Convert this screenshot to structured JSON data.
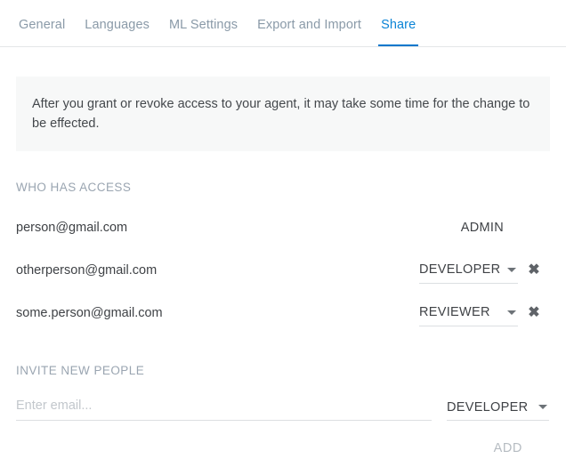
{
  "tabs": [
    {
      "label": "General",
      "active": false
    },
    {
      "label": "Languages",
      "active": false
    },
    {
      "label": "ML Settings",
      "active": false
    },
    {
      "label": "Export and Import",
      "active": false
    },
    {
      "label": "Share",
      "active": true
    }
  ],
  "notice": {
    "text": "After you grant or revoke access to your agent, it may take some time for the change to be effected."
  },
  "who_has_access": {
    "title": "WHO HAS ACCESS",
    "rows": [
      {
        "email": "person@gmail.com",
        "role": "ADMIN",
        "editable": false,
        "removable": false
      },
      {
        "email": "otherperson@gmail.com",
        "role": "DEVELOPER",
        "editable": true,
        "removable": true
      },
      {
        "email": "some.person@gmail.com",
        "role": "REVIEWER",
        "editable": true,
        "removable": true
      }
    ]
  },
  "invite": {
    "title": "INVITE NEW PEOPLE",
    "email_value": "",
    "email_placeholder": "Enter email...",
    "role": "DEVELOPER",
    "add_label": "ADD"
  },
  "icons": {
    "remove": "✖",
    "caret": "chevron-down-icon"
  },
  "colors": {
    "accent": "#0277cc",
    "tab_inactive": "#8a9aa8",
    "notice_bg": "#f7f8f8",
    "section_title": "#9aa5b1",
    "text": "#3f4246",
    "disabled": "#b6bcc2"
  }
}
